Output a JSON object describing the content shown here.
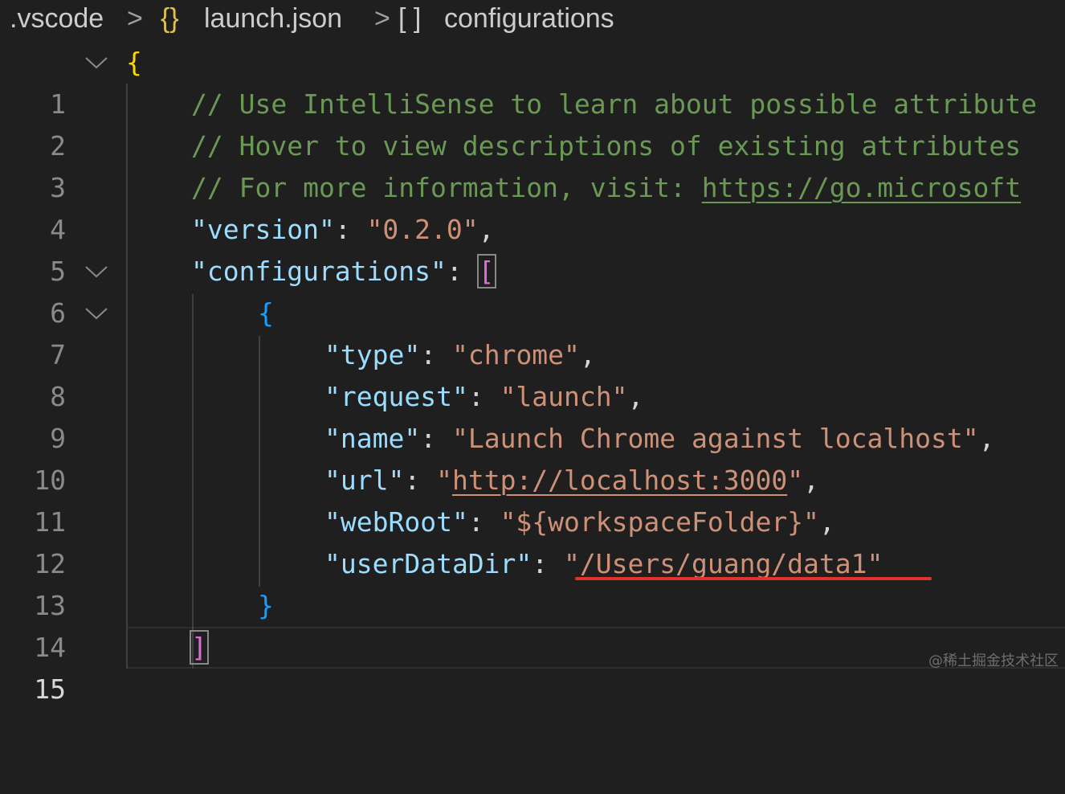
{
  "breadcrumb": {
    "folder": ".vscode",
    "sep1": ">",
    "file_icon": "{}",
    "file": "launch.json",
    "sep2": ">",
    "symbol_icon": "[ ]",
    "symbol": "configurations"
  },
  "gutter": {
    "line_numbers": [
      "1",
      "2",
      "3",
      "4",
      "5",
      "6",
      "7",
      "8",
      "9",
      "10",
      "11",
      "12",
      "13",
      "14",
      "15"
    ],
    "active_line": "15",
    "fold_icon": "chevron-down-icon"
  },
  "code": {
    "l1_brace": "{",
    "l2_comment": "// Use IntelliSense to learn about possible attribute",
    "l3_comment": "// Hover to view descriptions of existing attributes",
    "l4_comment": "// For more information, visit: ",
    "l4_link": "https://go.microsoft",
    "l5_key": "\"version\"",
    "l5_colon": ": ",
    "l5_value": "\"0.2.0\"",
    "l5_comma": ",",
    "l6_key": "\"configurations\"",
    "l6_colon": ": ",
    "l6_bracket": "[",
    "l7_brace": "{",
    "l8_key": "\"type\"",
    "l8_colon": ": ",
    "l8_value": "\"chrome\"",
    "l8_comma": ",",
    "l9_key": "\"request\"",
    "l9_colon": ": ",
    "l9_value": "\"launch\"",
    "l9_comma": ",",
    "l10_key": "\"name\"",
    "l10_colon": ": ",
    "l10_value": "\"Launch Chrome against localhost\"",
    "l10_comma": ",",
    "l11_key": "\"url\"",
    "l11_colon": ": ",
    "l11_q1": "\"",
    "l11_link": "http://localhost:3000",
    "l11_q2": "\"",
    "l11_comma": ",",
    "l12_key": "\"webRoot\"",
    "l12_colon": ": ",
    "l12_value": "\"${workspaceFolder}\"",
    "l12_comma": ",",
    "l13_key": "\"userDataDir\"",
    "l13_colon": ": ",
    "l13_value": "\"/Users/guang/data1\"",
    "l14_brace": "}",
    "l15_bracket": "]"
  },
  "watermark": "@稀土掘金技术社区",
  "colors": {
    "background": "#1f1f1f",
    "comment": "#6a9955",
    "key": "#9cdcfe",
    "string": "#ce9178",
    "annotation_underline": "#e0342a"
  }
}
